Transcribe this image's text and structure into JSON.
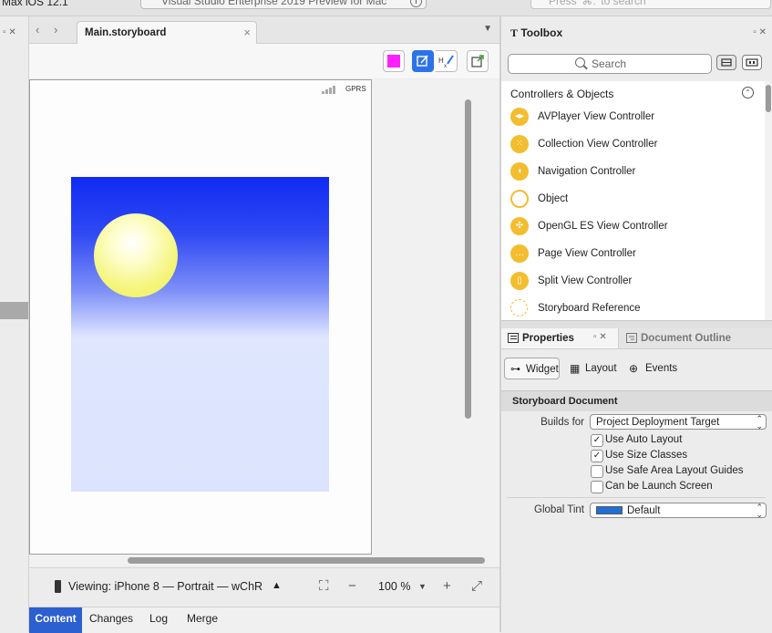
{
  "topbar": {
    "left_text": "Max iOS 12.1",
    "window_title": "Visual Studio Enterprise 2019 Preview for Mac",
    "search_placeholder": "Press '⌘.' to search"
  },
  "editor": {
    "tab_label": "Main.storyboard",
    "status_carrier": "GPRS",
    "viewing_text": "Viewing: iPhone 8 — Portrait — wChR",
    "zoom": "100 %",
    "bottom_tabs": [
      "Content",
      "Changes",
      "Log",
      "Merge"
    ],
    "active_bottom_tab": "Content",
    "colors": {
      "swatch": "#ff1fff",
      "accent": "#2c5fcf"
    }
  },
  "toolbox": {
    "title": "Toolbox",
    "search_placeholder": "Search",
    "section": "Controllers & Objects",
    "items": [
      {
        "label": "AVPlayer View Controller",
        "icon": "avplayer-icon"
      },
      {
        "label": "Collection View Controller",
        "icon": "collection-icon"
      },
      {
        "label": "Navigation Controller",
        "icon": "navigation-icon"
      },
      {
        "label": "Object",
        "icon": "object-icon"
      },
      {
        "label": "OpenGL ES View Controller",
        "icon": "opengl-icon"
      },
      {
        "label": "Page View Controller",
        "icon": "page-icon"
      },
      {
        "label": "Split View Controller",
        "icon": "split-icon"
      },
      {
        "label": "Storyboard Reference",
        "icon": "storyboard-reference-icon"
      }
    ]
  },
  "properties": {
    "tabs": [
      "Properties",
      "Document Outline"
    ],
    "subtabs": [
      "Widget",
      "Layout",
      "Events"
    ],
    "section_title": "Storyboard Document",
    "builds_for_label": "Builds for",
    "builds_for_value": "Project Deployment Target",
    "checkboxes": [
      {
        "label": "Use Auto Layout",
        "checked": true
      },
      {
        "label": "Use Size Classes",
        "checked": true
      },
      {
        "label": "Use Safe Area Layout Guides",
        "checked": false
      },
      {
        "label": "Can be Launch Screen",
        "checked": false
      }
    ],
    "global_tint_label": "Global Tint",
    "global_tint_value": "Default",
    "tint_color": "#1f6fd6"
  }
}
